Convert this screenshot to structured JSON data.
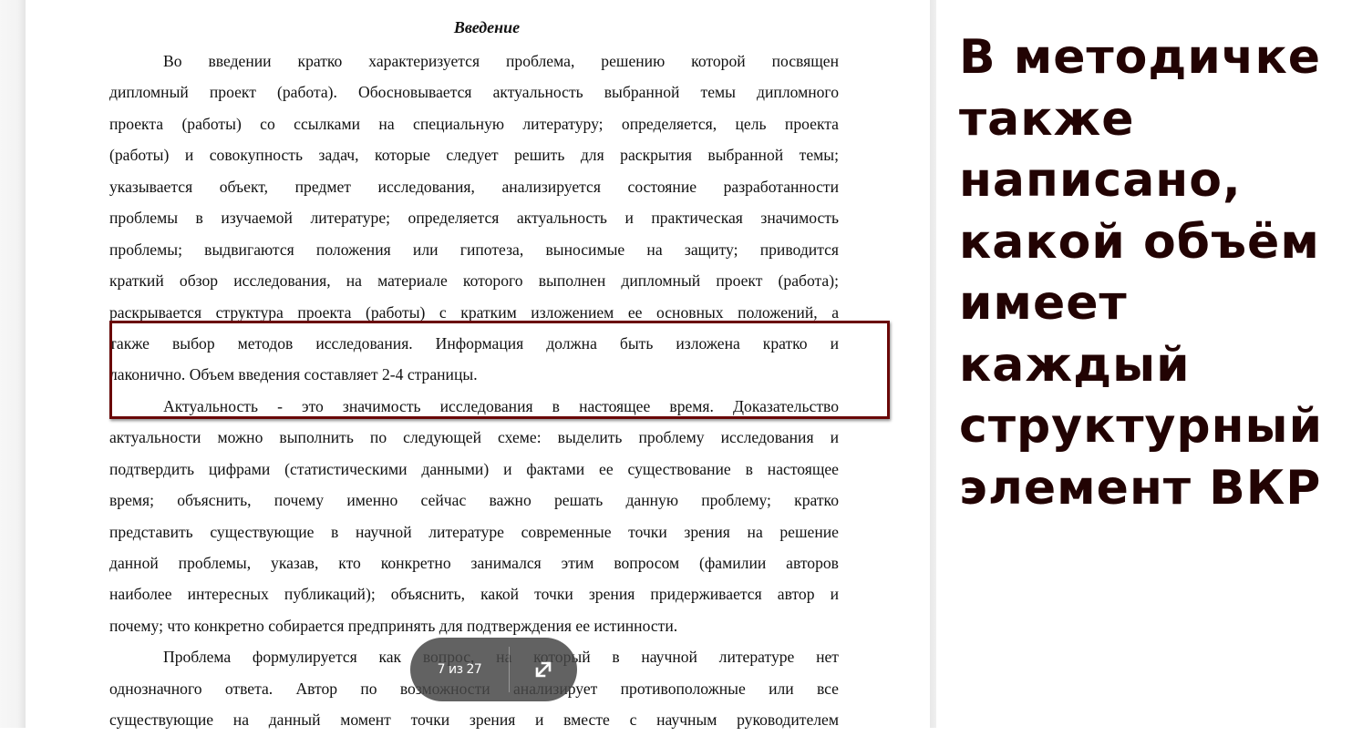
{
  "document": {
    "title": "Введение",
    "lines": [
      {
        "text": "Во введении кратко характеризуется проблема, решению которой посвящен",
        "indent": true
      },
      {
        "text": "дипломный проект (работа). Обосновывается актуальность выбранной темы дипломного"
      },
      {
        "text": "проекта (работы) со ссылками на специальную литературу; определяется, цель проекта"
      },
      {
        "text": "(работы) и совокупность задач, которые следует решить для раскрытия выбранной темы;"
      },
      {
        "text": "указывается объект, предмет исследования, анализируется состояние разработанности"
      },
      {
        "text": "проблемы в изучаемой литературе; определяется актуальность и практическая значимость"
      },
      {
        "text": "проблемы; выдвигаются положения или гипотеза, выносимые на защиту; приводится"
      },
      {
        "text": "краткий обзор исследования, на материале которого выполнен дипломный проект (работа);"
      },
      {
        "text": "раскрывается структура проекта (работы) с кратким изложением ее основных положений, а"
      },
      {
        "text": "также выбор методов исследования. Информация должна быть изложена кратко и"
      },
      {
        "text": "лаконично. Объем введения составляет  2-4 страницы.",
        "last": true
      },
      {
        "text": "Актуальность - это значимость исследования в настоящее время. Доказательство",
        "indent": true
      },
      {
        "text": "актуальности можно выполнить по следующей схеме: выделить проблему исследования и"
      },
      {
        "text": "подтвердить цифрами (статистическими данными) и фактами ее существование в настоящее"
      },
      {
        "text": "время; объяснить, почему именно сейчас важно решать данную проблему; кратко"
      },
      {
        "text": "представить существующие в научной литературе современные точки зрения на решение"
      },
      {
        "text": "данной проблемы, указав, кто конкретно занимался этим вопросом (фамилии авторов"
      },
      {
        "text": "наиболее интересных публикаций); объяснить, какой точки зрения придерживается автор и"
      },
      {
        "text": "почему; что конкретно собирается предпринять для подтверждения ее истинности.",
        "last": true
      },
      {
        "text": "Проблема формулируется как вопрос, на который в научной литературе нет",
        "indent": true
      },
      {
        "text": "однозначного ответа. Автор по возможности анализирует противоположные или все"
      },
      {
        "text": "существующие на данный момент точки зрения и вместе с научным руководителем"
      }
    ]
  },
  "highlight": {
    "color": "#6a0808",
    "covers": "также выбор методов исследования. Информация должна быть изложена кратко и лаконично. Объем введения составляет 2-4 страницы."
  },
  "side_note": {
    "color": "#220303",
    "lines": [
      "В методичке",
      "также",
      "написано,",
      "какой объём",
      "имеет",
      "каждый",
      "структурный",
      "элемент ВКР"
    ]
  },
  "pager": {
    "label": "7 из 27",
    "current_page": 7,
    "total_pages": 27,
    "expand_icon": "expand-arrows-icon"
  }
}
